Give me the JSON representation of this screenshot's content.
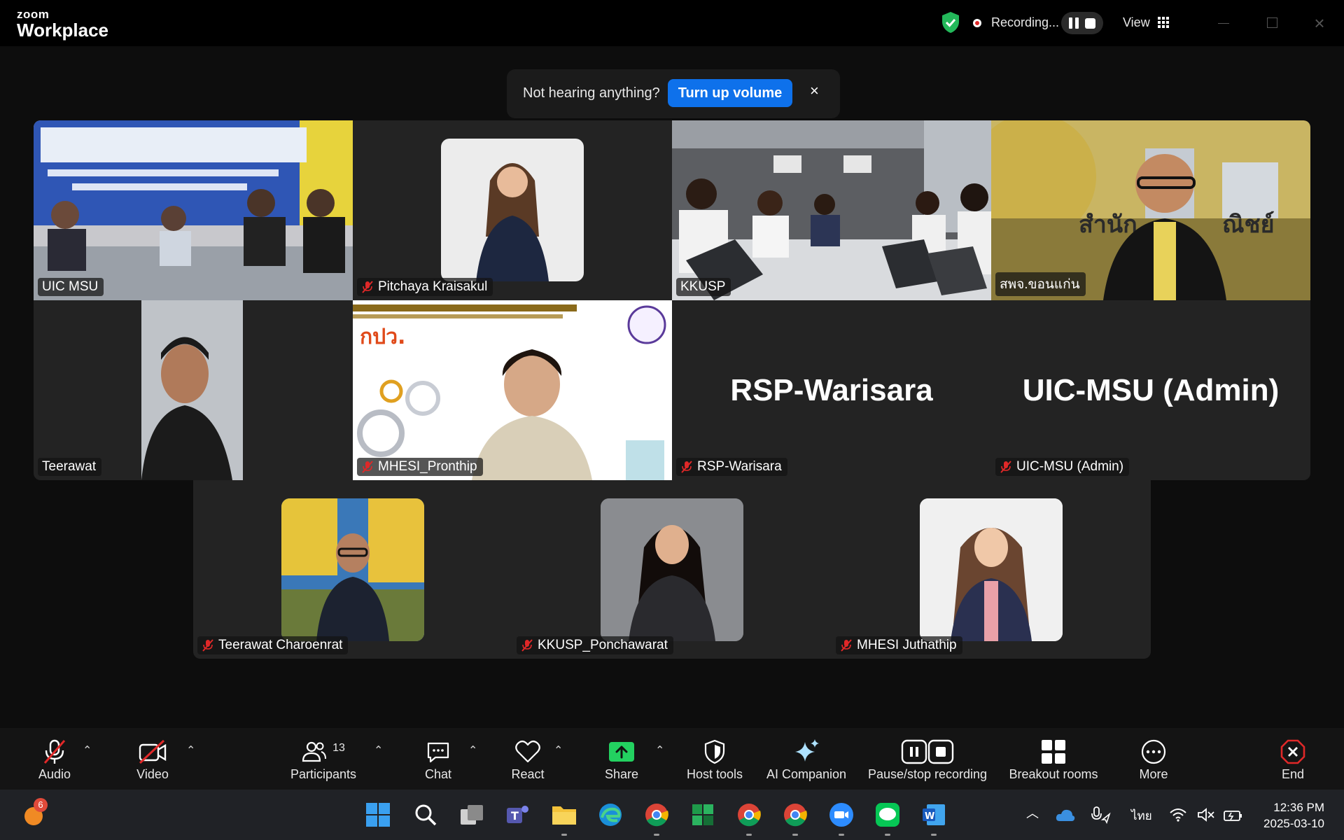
{
  "app": {
    "brand_top": "zoom",
    "brand_bottom": "Workplace"
  },
  "titlebar": {
    "recording_text": "Recording...",
    "view_label": "View",
    "colors": {
      "shield": "#23b85a",
      "record_dot": "#e02828"
    }
  },
  "notification": {
    "text": "Not hearing anything?",
    "button": "Turn up volume",
    "close": "×"
  },
  "tiles": [
    {
      "name": "UIC MSU",
      "muted": false
    },
    {
      "name": "Pitchaya Kraisakul",
      "muted": true
    },
    {
      "name": "KKUSP",
      "muted": false,
      "active_speaker": true
    },
    {
      "name": "สพจ.ขอนแก่น",
      "muted": false
    },
    {
      "name": "Teerawat",
      "muted": false
    },
    {
      "name": "MHESI_Pronthip",
      "muted": true
    },
    {
      "name": "RSP-Warisara",
      "muted": true,
      "display_name": "RSP-Warisara"
    },
    {
      "name": "UIC-MSU (Admin)",
      "muted": true,
      "display_name": "UIC-MSU (Admin)"
    },
    {
      "name": "Teerawat Charoenrat",
      "muted": true
    },
    {
      "name": "KKUSP_Ponchawarat",
      "muted": true
    },
    {
      "name": "MHESI Juthathip",
      "muted": true
    }
  ],
  "toolbar": {
    "audio": "Audio",
    "video": "Video",
    "participants": "Participants",
    "participants_count": "13",
    "chat": "Chat",
    "react": "React",
    "share": "Share",
    "host_tools": "Host tools",
    "ai_companion": "AI Companion",
    "pause_stop_recording": "Pause/stop recording",
    "breakout_rooms": "Breakout rooms",
    "more": "More",
    "end": "End",
    "colors": {
      "share": "#23d160",
      "end": "#e02828",
      "muted": "#e02828"
    }
  },
  "taskbar": {
    "notification_badge": "6",
    "language": "ไทย",
    "time": "12:36 PM",
    "date": "2025-03-10"
  }
}
